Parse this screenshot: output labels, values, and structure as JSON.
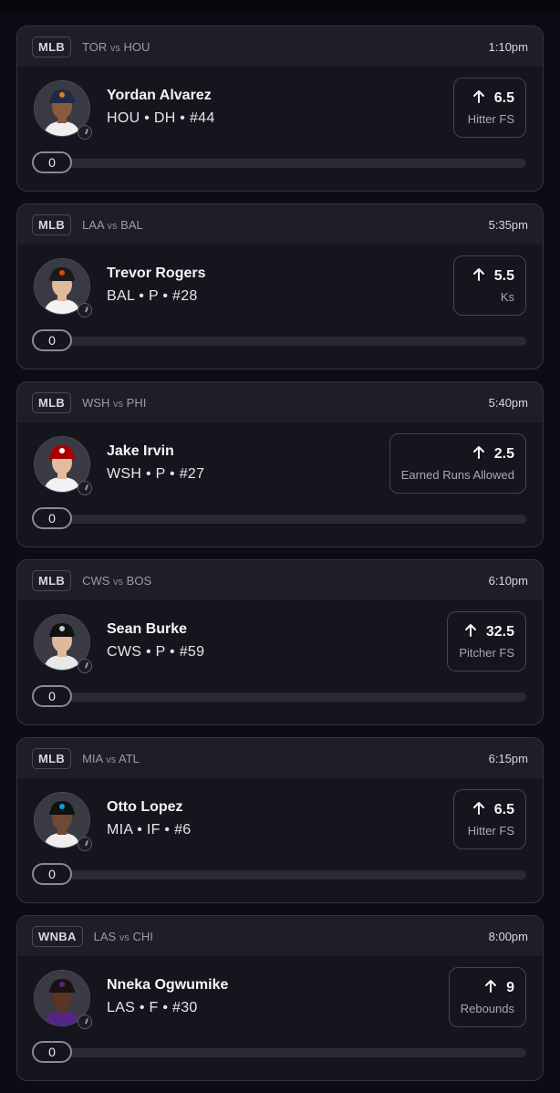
{
  "colors": {
    "background": "#0c0c14",
    "card": "#15151e",
    "card_header": "#1e1e28",
    "border": "#34343f",
    "muted_text": "#9c9ca8"
  },
  "cards": [
    {
      "league": "MLB",
      "team1": "TOR",
      "vs": "vs",
      "team2": "HOU",
      "time": "1:10pm",
      "player_name": "Yordan Alvarez",
      "player_info": "HOU • DH • #44",
      "direction_icon": "arrow-up-icon",
      "line": "6.5",
      "stat": "Hitter FS",
      "count": "0",
      "progress": 0,
      "avatar": {
        "cap": "#1f2a48",
        "logo": "#e87722",
        "skin": "#8a5a3c",
        "jersey": "#eeeeee",
        "bg": "#3a3a44"
      }
    },
    {
      "league": "MLB",
      "team1": "LAA",
      "vs": "vs",
      "team2": "BAL",
      "time": "5:35pm",
      "player_name": "Trevor Rogers",
      "player_info": "BAL • P • #28",
      "direction_icon": "arrow-up-icon",
      "line": "5.5",
      "stat": "Ks",
      "count": "0",
      "progress": 0,
      "avatar": {
        "cap": "#1a1a1a",
        "logo": "#df4601",
        "skin": "#e0b89a",
        "jersey": "#f2f2f2",
        "bg": "#3a3a44"
      }
    },
    {
      "league": "MLB",
      "team1": "WSH",
      "vs": "vs",
      "team2": "PHI",
      "time": "5:40pm",
      "player_name": "Jake Irvin",
      "player_info": "WSH • P • #27",
      "direction_icon": "arrow-up-icon",
      "line": "2.5",
      "stat": "Earned Runs Allowed",
      "count": "0",
      "progress": 0,
      "avatar": {
        "cap": "#ab0003",
        "logo": "#ffffff",
        "skin": "#e3bca0",
        "jersey": "#f2f2f2",
        "bg": "#3a3a44"
      }
    },
    {
      "league": "MLB",
      "team1": "CWS",
      "vs": "vs",
      "team2": "BOS",
      "time": "6:10pm",
      "player_name": "Sean Burke",
      "player_info": "CWS • P • #59",
      "direction_icon": "arrow-up-icon",
      "line": "32.5",
      "stat": "Pitcher FS",
      "count": "0",
      "progress": 0,
      "avatar": {
        "cap": "#111111",
        "logo": "#c4ced4",
        "skin": "#e0b89a",
        "jersey": "#e8e8e8",
        "bg": "#3a3a44"
      }
    },
    {
      "league": "MLB",
      "team1": "MIA",
      "vs": "vs",
      "team2": "ATL",
      "time": "6:15pm",
      "player_name": "Otto Lopez",
      "player_info": "MIA • IF • #6",
      "direction_icon": "arrow-up-icon",
      "line": "6.5",
      "stat": "Hitter FS",
      "count": "0",
      "progress": 0,
      "avatar": {
        "cap": "#111111",
        "logo": "#00a3e0",
        "skin": "#6e4a34",
        "jersey": "#eeeeee",
        "bg": "#3a3a44"
      }
    },
    {
      "league": "WNBA",
      "team1": "LAS",
      "vs": "vs",
      "team2": "CHI",
      "time": "8:00pm",
      "player_name": "Nneka Ogwumike",
      "player_info": "LAS • F • #30",
      "direction_icon": "arrow-up-icon",
      "line": "9",
      "stat": "Rebounds",
      "count": "0",
      "progress": 0,
      "avatar": {
        "cap": "#1a1210",
        "logo": "#552583",
        "skin": "#5a3524",
        "jersey": "#552583",
        "bg": "#3a3a44"
      }
    }
  ]
}
